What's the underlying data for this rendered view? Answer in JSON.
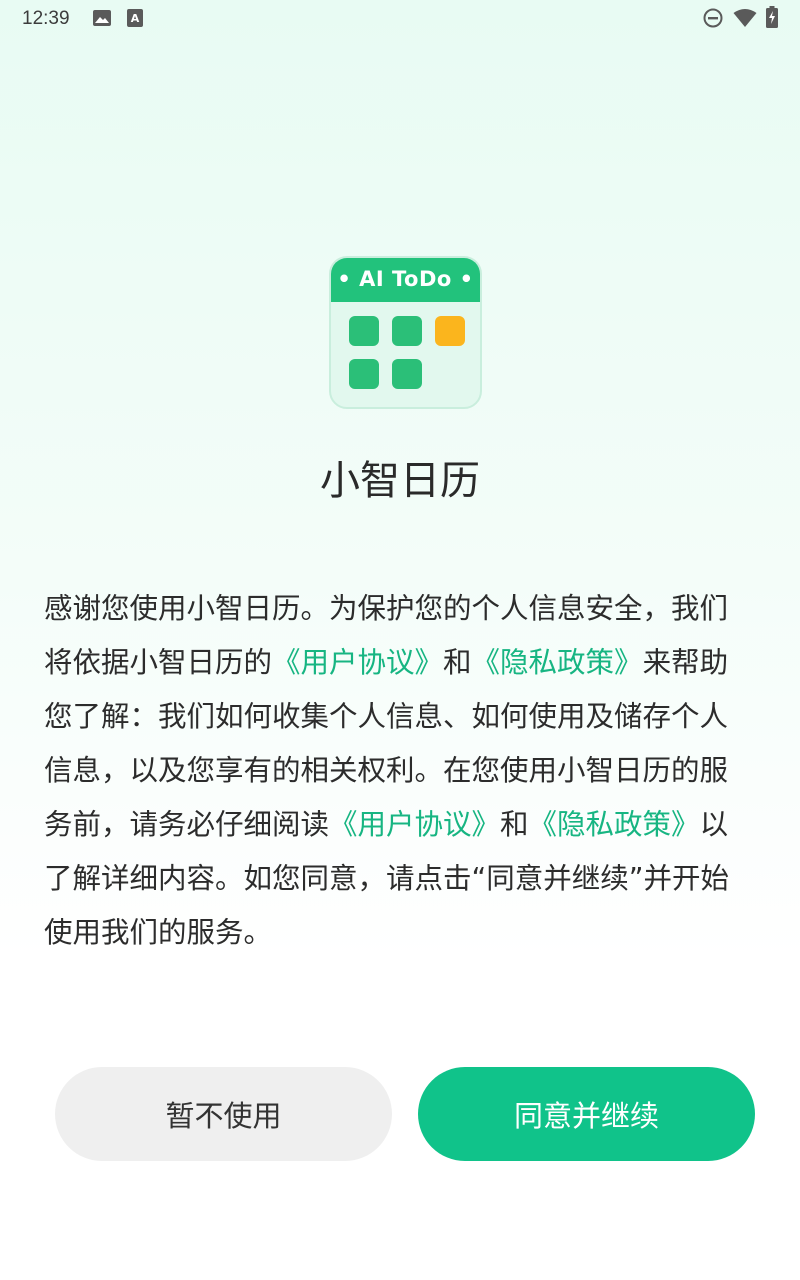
{
  "status_bar": {
    "time": "12:39",
    "icons": [
      "image-icon",
      "text-a-icon",
      "do-not-disturb-icon",
      "wifi-icon",
      "battery-icon"
    ]
  },
  "app": {
    "icon_label": "AI ToDo",
    "icon_label_left_dot": "•",
    "icon_label_right_dot": "•",
    "name": "小智日历"
  },
  "colors": {
    "accent": "#10c38a",
    "link": "#17b582",
    "icon_green": "#22c27c",
    "icon_orange": "#fbb51d"
  },
  "agreement": {
    "line1": "感谢您使用小智日历。为保护您的个人信息安全，我们",
    "line2_a": "将依据小智日历的",
    "line2_link1": "《用户协议》",
    "line2_b": "和",
    "line2_link2": "《隐私政策》",
    "line2_c": "来帮助",
    "line3": "您了解：我们如何收集个人信息、如何使用及储存个人",
    "line4": "信息，以及您享有的相关权利。在您使用小智日历的服",
    "line5_a": "务前，请务必仔细阅读",
    "line5_link1": "《用户协议》",
    "line5_b": "和",
    "line5_link2": "《隐私政策》",
    "line5_c": "以",
    "line6": "了解详细内容。如您同意，请点击“同意并继续”并开始",
    "line7": "使用我们的服务。"
  },
  "buttons": {
    "decline_label": "暂不使用",
    "agree_label": "同意并继续"
  }
}
